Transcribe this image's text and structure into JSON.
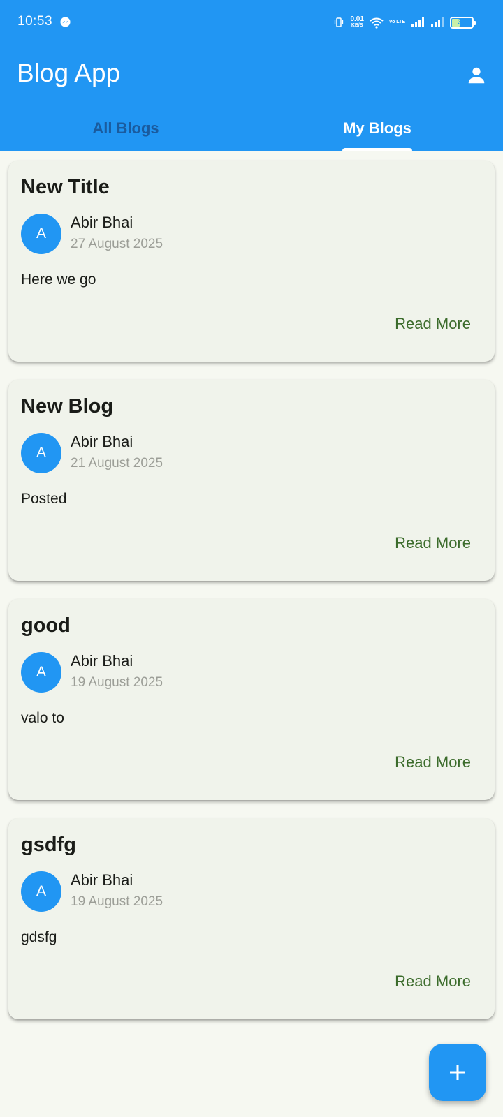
{
  "status_bar": {
    "time": "10:53",
    "net_speed": "0.01",
    "net_speed_unit": "KB/S",
    "volte": "Vo LTE",
    "battery": "35",
    "battery_level": 0.35
  },
  "app_bar": {
    "title": "Blog App",
    "profile_icon": "person-icon"
  },
  "tabs": [
    {
      "label": "All Blogs",
      "active": false
    },
    {
      "label": "My Blogs",
      "active": true
    }
  ],
  "blogs": [
    {
      "title": "New Title",
      "avatar": "A",
      "author": "Abir Bhai",
      "date": "27 August 2025",
      "content": "Here we go",
      "action": "Read More"
    },
    {
      "title": "New Blog",
      "avatar": "A",
      "author": "Abir Bhai",
      "date": "21 August 2025",
      "content": "Posted",
      "action": "Read More"
    },
    {
      "title": "good",
      "avatar": "A",
      "author": "Abir Bhai",
      "date": "19 August 2025",
      "content": "valo to",
      "action": "Read More"
    },
    {
      "title": "gsdfg",
      "avatar": "A",
      "author": "Abir Bhai",
      "date": "19 August 2025",
      "content": "gdsfg",
      "action": "Read More"
    }
  ],
  "fab": {
    "icon": "plus-icon"
  },
  "colors": {
    "primary": "#2196f3",
    "background": "#f6f8f1",
    "card": "#f0f3eb",
    "read_more": "#3b6b2b",
    "inactive_tab": "#1a5b9e"
  }
}
